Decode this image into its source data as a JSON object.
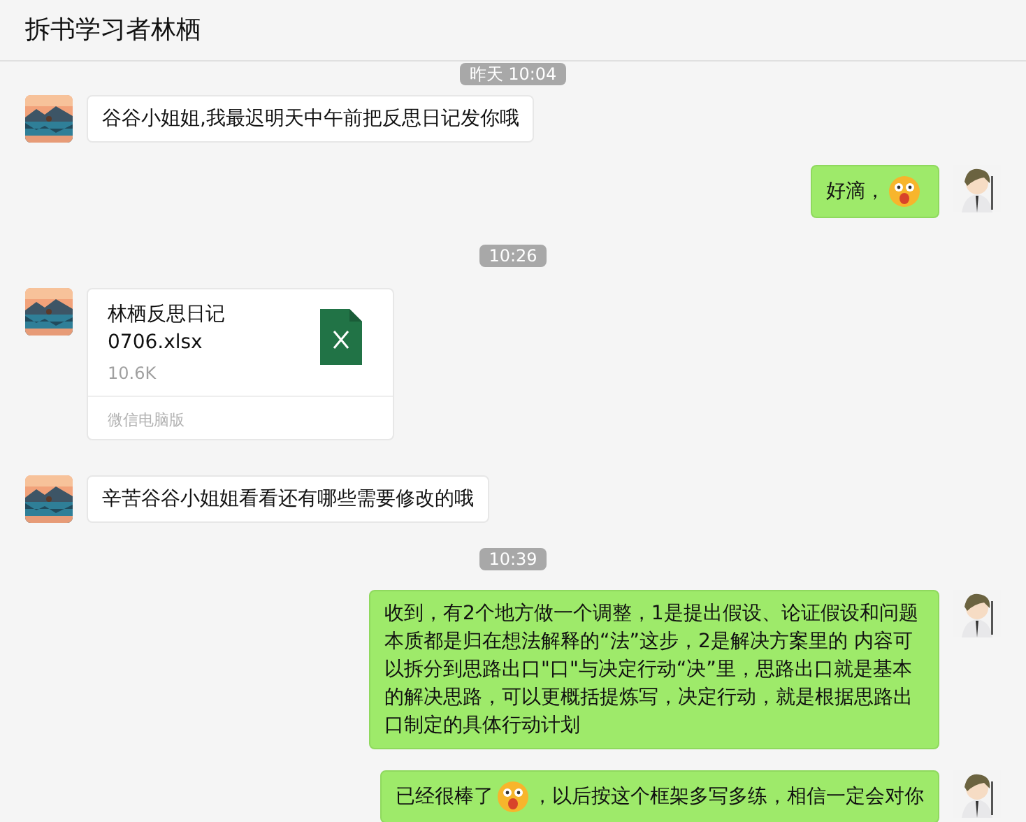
{
  "window": {
    "title": "拆书学习者林栖"
  },
  "messages": [
    {
      "kind": "time",
      "text": "昨天 10:04"
    },
    {
      "kind": "text",
      "outgoing": false,
      "parts": [
        {
          "kind": "text",
          "text": "谷谷小姐姐,我最迟明天中午前把反思日记发你哦"
        }
      ]
    },
    {
      "kind": "text",
      "outgoing": true,
      "parts": [
        {
          "kind": "text",
          "text": "好滴，"
        },
        {
          "kind": "emoji"
        }
      ]
    },
    {
      "kind": "time",
      "text": "10:26"
    },
    {
      "kind": "file",
      "outgoing": false,
      "name": "林栖反思日记0706.xlsx",
      "size": "10.6K",
      "source": "微信电脑版"
    },
    {
      "kind": "text",
      "outgoing": false,
      "parts": [
        {
          "kind": "text",
          "text": "辛苦谷谷小姐姐看看还有哪些需要修改的哦"
        }
      ]
    },
    {
      "kind": "time",
      "text": "10:39"
    },
    {
      "kind": "text",
      "outgoing": true,
      "parts": [
        {
          "kind": "text",
          "text": "收到，有2个地方做一个调整，1是提出假设、论证假设和问题本质都是归在想法解释的“法”这步，2是解决方案里的 内容可以拆分到思路出口\"口\"与决定行动“决”里，思路出口就是基本的解决思路，可以更概括提炼写，决定行动，就是根据思路出口制定的具体行动计划"
        }
      ]
    },
    {
      "kind": "text",
      "outgoing": true,
      "parts": [
        {
          "kind": "text",
          "text": "已经很棒了"
        },
        {
          "kind": "emoji"
        },
        {
          "kind": "text",
          "text": "，以后按这个框架多写多练，相信一定会对你"
        }
      ]
    }
  ]
}
